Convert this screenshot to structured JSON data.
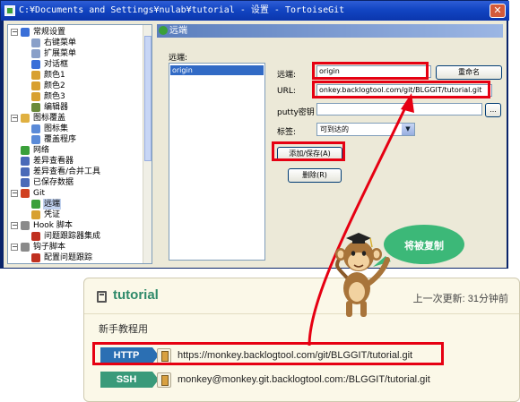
{
  "window": {
    "title": "C:¥Documents and Settings¥nulab¥tutorial - 设置 - TortoiseGit",
    "close_glyph": "✕"
  },
  "tree": {
    "items": [
      {
        "label": "常规设置",
        "icon": "wrench-icon",
        "color": "#3a6fd8",
        "level": 0,
        "toggle": "−"
      },
      {
        "label": "右键菜单",
        "icon": "menu-icon",
        "color": "#8aa0c8",
        "level": 1,
        "toggle": ""
      },
      {
        "label": "扩展菜单",
        "icon": "menu-icon",
        "color": "#8aa0c8",
        "level": 1,
        "toggle": ""
      },
      {
        "label": "对话框",
        "icon": "dialog-icon",
        "color": "#3a6fd8",
        "level": 1,
        "toggle": ""
      },
      {
        "label": "颜色1",
        "icon": "brush-icon",
        "color": "#d8a030",
        "level": 1,
        "toggle": ""
      },
      {
        "label": "颜色2",
        "icon": "brush-icon",
        "color": "#d8a030",
        "level": 1,
        "toggle": ""
      },
      {
        "label": "颜色3",
        "icon": "brush-icon",
        "color": "#d8a030",
        "level": 1,
        "toggle": ""
      },
      {
        "label": "编辑器",
        "icon": "editor-icon",
        "color": "#6a8a3a",
        "level": 1,
        "toggle": ""
      },
      {
        "label": "图标覆盖",
        "icon": "overlay-icon",
        "color": "#e0b040",
        "level": 0,
        "toggle": "−"
      },
      {
        "label": "图标集",
        "icon": "iconset-icon",
        "color": "#5a8ad8",
        "level": 1,
        "toggle": ""
      },
      {
        "label": "覆盖程序",
        "icon": "handler-icon",
        "color": "#5a8ad8",
        "level": 1,
        "toggle": ""
      },
      {
        "label": "网络",
        "icon": "network-icon",
        "color": "#3aa03a",
        "level": 0,
        "toggle": ""
      },
      {
        "label": "差异查看器",
        "icon": "diff-icon",
        "color": "#4a6ab8",
        "level": 0,
        "toggle": ""
      },
      {
        "label": "差异查看/合并工具",
        "icon": "merge-icon",
        "color": "#4a6ab8",
        "level": 0,
        "toggle": ""
      },
      {
        "label": "已保存数据",
        "icon": "saved-data-icon",
        "color": "#4a6ab8",
        "level": 0,
        "toggle": ""
      },
      {
        "label": "Git",
        "icon": "git-icon",
        "color": "#d04020",
        "level": 0,
        "toggle": "−"
      },
      {
        "label": "远端",
        "icon": "remote-icon",
        "color": "#3aa03a",
        "level": 1,
        "toggle": "",
        "selected": true
      },
      {
        "label": "凭证",
        "icon": "credential-icon",
        "color": "#d8a030",
        "level": 1,
        "toggle": ""
      },
      {
        "label": "Hook 脚本",
        "icon": "hook-icon",
        "color": "#8a8a8a",
        "level": 0,
        "toggle": "−"
      },
      {
        "label": "问题跟踪器集成",
        "icon": "bug-icon",
        "color": "#c03020",
        "level": 1,
        "toggle": ""
      },
      {
        "label": "钩子脚本",
        "icon": "hook-icon",
        "color": "#8a8a8a",
        "level": 0,
        "toggle": "−"
      },
      {
        "label": "配置问题跟踪",
        "icon": "bug-icon",
        "color": "#c03020",
        "level": 1,
        "toggle": ""
      }
    ]
  },
  "panel": {
    "header": "远端",
    "section_label": "远端:",
    "remotes": [
      "origin"
    ],
    "remote_label": "远端:",
    "remote_value": "origin",
    "rename_button": "重命名",
    "url_label": "URL:",
    "url_value": "onkey.backlogtool.com/git/BLGGIT/tutorial.git",
    "putty_label": "putty密钥",
    "putty_value": "",
    "browse_button": "...",
    "tag_label": "标签:",
    "tag_value": "可到达的",
    "add_save_button": "添加/保存(A)",
    "delete_button": "删除(R)"
  },
  "card": {
    "name": "tutorial",
    "updated": "上一次更新: 31分钟前",
    "description": "新手教程用",
    "http_label": "HTTP",
    "http_url": "https://monkey.backlogtool.com/git/BLGGIT/tutorial.git",
    "ssh_label": "SSH",
    "ssh_url": "monkey@monkey.git.backlogtool.com:/BLGGIT/tutorial.git"
  },
  "callout": {
    "text": "将被复制"
  },
  "colors": {
    "highlight": "#e60012",
    "bubble": "#3cb878",
    "titlebar": "#1245c2"
  }
}
